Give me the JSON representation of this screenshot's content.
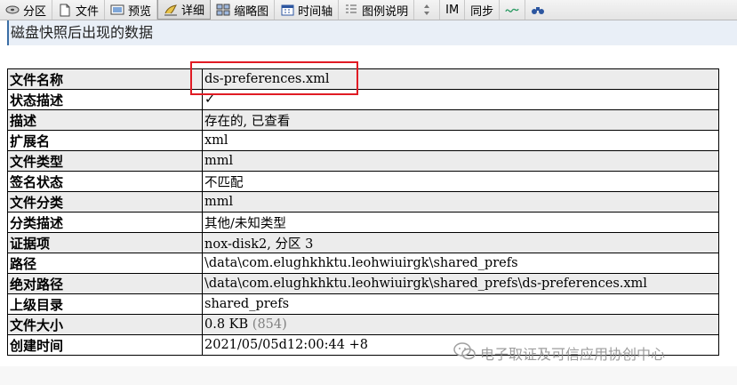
{
  "toolbar": {
    "items": [
      {
        "label": "分区",
        "icon": "disk-icon"
      },
      {
        "label": "文件",
        "icon": "document-icon"
      },
      {
        "label": "预览",
        "icon": "preview-icon"
      },
      {
        "label": "详细",
        "icon": "detail-icon",
        "active": true
      },
      {
        "label": "缩略图",
        "icon": "thumbnail-icon"
      },
      {
        "label": "时间轴",
        "icon": "calendar-icon"
      },
      {
        "label": "图例说明",
        "icon": "legend-icon"
      },
      {
        "label": "",
        "icon": "sort-icon"
      },
      {
        "label": "IM"
      },
      {
        "label": "同步"
      },
      {
        "label": "",
        "icon": "wave-icon"
      },
      {
        "label": "",
        "icon": "binoculars-icon"
      }
    ]
  },
  "caption": "磁盘快照后出现的数据",
  "properties": [
    {
      "key": "文件名称",
      "value": "ds-preferences.xml"
    },
    {
      "key": "状态描述",
      "value": "✓"
    },
    {
      "key": "描述",
      "value": "存在的, 已查看"
    },
    {
      "key": "扩展名",
      "value": "xml"
    },
    {
      "key": "文件类型",
      "value": "mml"
    },
    {
      "key": "签名状态",
      "value": "不匹配"
    },
    {
      "key": "文件分类",
      "value": "mml"
    },
    {
      "key": "分类描述",
      "value": "其他/未知类型"
    },
    {
      "key": "证据项",
      "value": "nox-disk2, 分区 3"
    },
    {
      "key": "路径",
      "value": "\\data\\com.elughkhktu.leohwiuirgk\\shared_prefs"
    },
    {
      "key": "绝对路径",
      "value": "\\data\\com.elughkhktu.leohwiuirgk\\shared_prefs\\ds-preferences.xml"
    },
    {
      "key": "上级目录",
      "value": "shared_prefs"
    },
    {
      "key": "文件大小",
      "value": "0.8 KB",
      "extra": "(854)"
    },
    {
      "key": "创建时间",
      "value": "2021/05/05d12:00:44 +8"
    }
  ],
  "watermark": "电子取证及可信应用协创中心",
  "colors": {
    "highlight": "#e01b24",
    "accent": "#3a6ea5"
  }
}
